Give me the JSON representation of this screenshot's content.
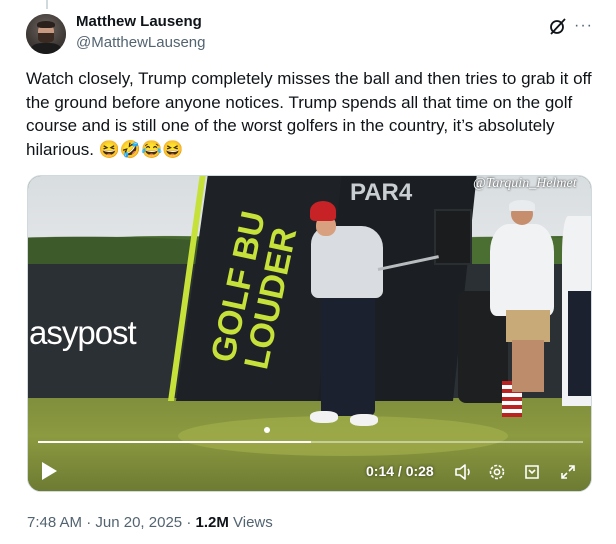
{
  "author": {
    "name": "Matthew Lauseng",
    "handle": "@MatthewLauseng"
  },
  "tweet": {
    "text": "Watch closely, Trump completely misses the ball and then tries to grab it off the ground before anyone notices. Trump spends all that time on the golf course and is still one of the worst golfers in the country, it’s absolutely hilarious. 😆🤣😂😆"
  },
  "media": {
    "sponsor_text": "asypost",
    "sign_line1": "GOLF BU",
    "sign_line2": "LOUDER",
    "par_label": "PAR4",
    "watermark": "@Tarquin_Helmet",
    "progress": 0.5,
    "time_display": "0:14 / 0:28"
  },
  "meta": {
    "time": "7:48 AM",
    "date": "Jun 20, 2025",
    "separator": "·",
    "views_count": "1.2M",
    "views_label": "Views"
  },
  "icons": {
    "grok": "grok-icon",
    "more": "more-icon",
    "play": "play-icon",
    "volume": "volume-icon",
    "settings": "gear-icon",
    "captions": "captions-icon",
    "fullscreen": "expand-icon"
  }
}
